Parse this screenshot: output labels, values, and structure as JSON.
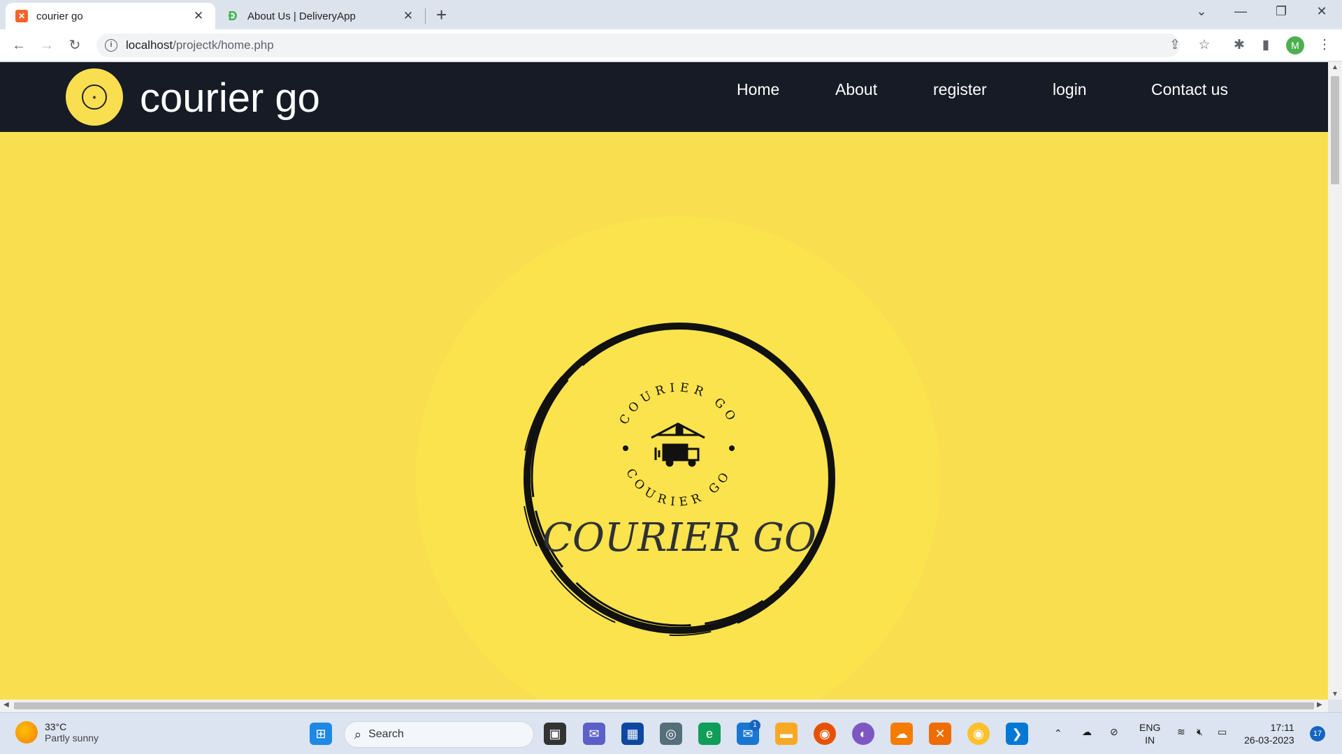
{
  "browser": {
    "tabs": [
      {
        "title": "courier go",
        "active": true,
        "icon": "xampp-icon"
      },
      {
        "title": "About Us | DeliveryApp",
        "active": false,
        "icon": "deliveryapp-icon"
      }
    ],
    "url_host": "localhost",
    "url_path": "/projectk/home.php",
    "profile_initial": "M"
  },
  "site": {
    "brand": "courier go",
    "nav": [
      "Home",
      "About",
      "register",
      "login",
      "Contact us"
    ],
    "hero": {
      "arc_text_top": "COURIER GO",
      "arc_text_bottom": "COURIER GO",
      "wordmark": "COURIER GO"
    },
    "colors": {
      "header_bg": "#161b26",
      "page_bg": "#f9df4f",
      "text": "#ffffff"
    }
  },
  "taskbar": {
    "weather_temp": "33°C",
    "weather_desc": "Partly sunny",
    "search_placeholder": "Search",
    "mail_badge": "1",
    "lang_top": "ENG",
    "lang_bottom": "IN",
    "time": "17:11",
    "date": "26-03-2023",
    "notif_count": "17"
  }
}
